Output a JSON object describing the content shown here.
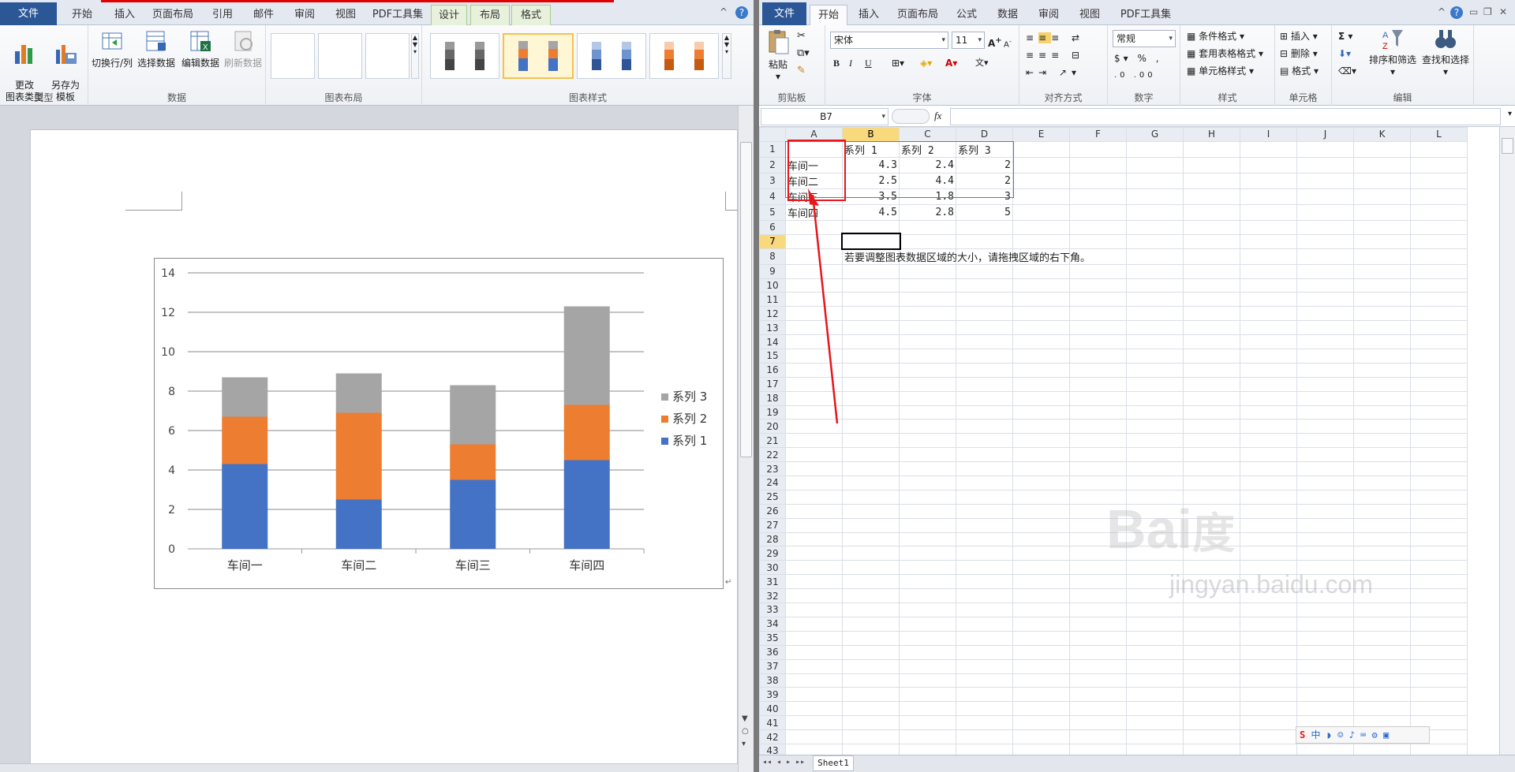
{
  "word": {
    "tabs": [
      "文件",
      "开始",
      "插入",
      "页面布局",
      "引用",
      "邮件",
      "审阅",
      "视图",
      "PDF工具集",
      "设计",
      "布局",
      "格式"
    ],
    "ribbon": {
      "type_group": {
        "label": "类型",
        "change_type": "更改\n图表类型",
        "save_template": "另存为\n模板"
      },
      "data_group": {
        "label": "数据",
        "switch_row_col": "切换行/列",
        "select_data": "选择数据",
        "edit_data": "编辑数据",
        "refresh_data": "刷新数据"
      },
      "layout_group": {
        "label": "图表布局"
      },
      "style_group": {
        "label": "图表样式"
      }
    },
    "chart_data": {
      "type": "bar",
      "stacked": true,
      "categories": [
        "车间一",
        "车间二",
        "车间三",
        "车间四"
      ],
      "series": [
        {
          "name": "系列 1",
          "values": [
            4.3,
            2.5,
            3.5,
            4.5
          ],
          "color": "#4472c4"
        },
        {
          "name": "系列 2",
          "values": [
            2.4,
            4.4,
            1.8,
            2.8
          ],
          "color": "#ed7d31"
        },
        {
          "name": "系列 3",
          "values": [
            2,
            2,
            3,
            5
          ],
          "color": "#a5a5a5"
        }
      ],
      "ylim": [
        0,
        14
      ],
      "yticks": [
        0,
        2,
        4,
        6,
        8,
        10,
        12,
        14
      ],
      "grid": true,
      "legend": "right"
    }
  },
  "excel": {
    "tabs": [
      "文件",
      "开始",
      "插入",
      "页面布局",
      "公式",
      "数据",
      "审阅",
      "视图",
      "PDF工具集"
    ],
    "ribbon": {
      "clipboard": {
        "label": "剪贴板",
        "paste": "粘贴"
      },
      "font": {
        "label": "字体",
        "name": "宋体",
        "size": "11",
        "bold": "B",
        "italic": "I",
        "underline": "U"
      },
      "align": {
        "label": "对齐方式"
      },
      "number": {
        "label": "数字",
        "format": "常规"
      },
      "styles": {
        "label": "样式",
        "conditional": "条件格式",
        "table_format": "套用表格格式",
        "cell_styles": "单元格样式"
      },
      "cells": {
        "label": "单元格",
        "insert": "插入",
        "delete": "删除",
        "format": "格式"
      },
      "editing": {
        "label": "编辑",
        "sum": "Σ",
        "sort_filter": "排序和筛选",
        "find_select": "查找和选择"
      }
    },
    "name_box": "B7",
    "fx": "fx",
    "columns": [
      "A",
      "B",
      "C",
      "D",
      "E",
      "F",
      "G",
      "H",
      "I",
      "J",
      "K",
      "L"
    ],
    "row_count": 44,
    "cells": {
      "1": {
        "B": "系列 1",
        "C": "系列 2",
        "D": "系列 3"
      },
      "2": {
        "A": "车间一",
        "B": "4.3",
        "C": "2.4",
        "D": "2"
      },
      "3": {
        "A": "车间二",
        "B": "2.5",
        "C": "4.4",
        "D": "2"
      },
      "4": {
        "A": "车间三",
        "B": "3.5",
        "C": "1.8",
        "D": "3"
      },
      "5": {
        "A": "车间四",
        "B": "4.5",
        "C": "2.8",
        "D": "5"
      },
      "8": {
        "B": "若要调整图表数据区域的大小，请拖拽区域的右下角。"
      }
    },
    "selected_cell": "B7",
    "sheet_tab": "Sheet1",
    "ime_text": "中",
    "watermark_url": "jingyan.baidu.com"
  }
}
